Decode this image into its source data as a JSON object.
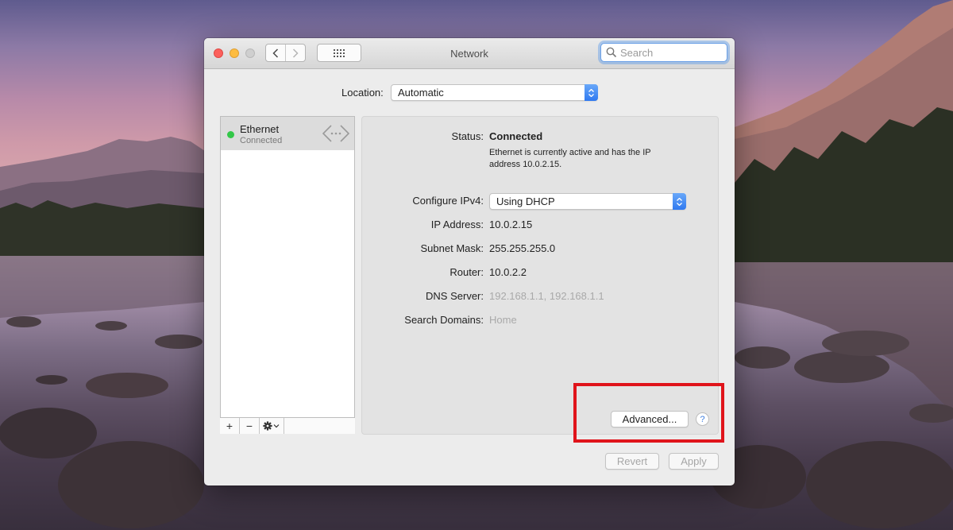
{
  "window": {
    "title": "Network",
    "search_placeholder": "Search"
  },
  "location": {
    "label": "Location:",
    "value": "Automatic"
  },
  "services": [
    {
      "name": "Ethernet",
      "status": "Connected",
      "status_color": "#33c748"
    }
  ],
  "list_toolbar": {
    "add": "+",
    "remove": "−"
  },
  "details": {
    "status_label": "Status:",
    "status_value": "Connected",
    "status_description": "Ethernet is currently active and has the IP address 10.0.2.15.",
    "configure_label": "Configure IPv4:",
    "configure_value": "Using DHCP",
    "ip_label": "IP Address:",
    "ip_value": "10.0.2.15",
    "subnet_label": "Subnet Mask:",
    "subnet_value": "255.255.255.0",
    "router_label": "Router:",
    "router_value": "10.0.2.2",
    "dns_label": "DNS Server:",
    "dns_value": "192.168.1.1, 192.168.1.1",
    "domains_label": "Search Domains:",
    "domains_value": "Home"
  },
  "buttons": {
    "advanced": "Advanced...",
    "help": "?",
    "revert": "Revert",
    "apply": "Apply"
  },
  "colors": {
    "highlight": "#e0141b",
    "popup_accent": "#2f79f0"
  }
}
